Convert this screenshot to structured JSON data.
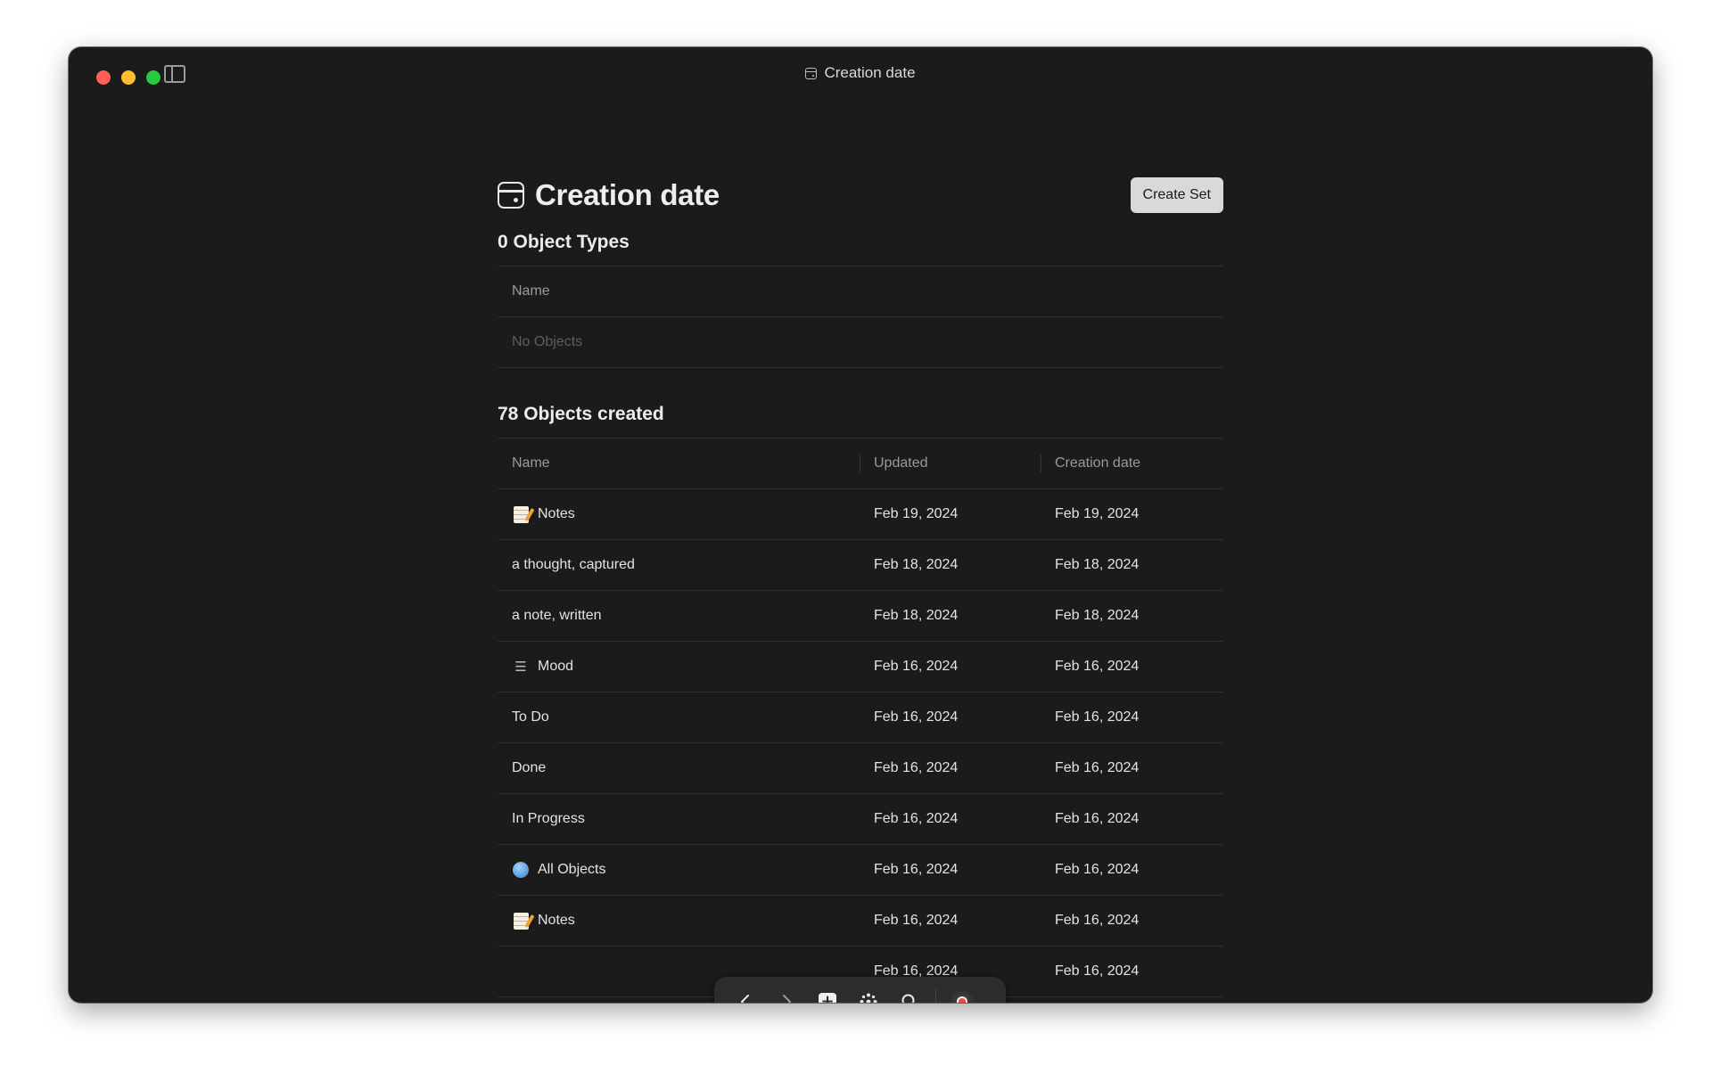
{
  "titlebar": {
    "title": "Creation date"
  },
  "header": {
    "title": "Creation date",
    "create_set_label": "Create Set"
  },
  "object_types": {
    "title": "0 Object Types",
    "column_name": "Name",
    "empty_text": "No Objects"
  },
  "objects": {
    "title": "78 Objects created",
    "columns": {
      "name": "Name",
      "updated": "Updated",
      "created": "Creation date"
    },
    "rows": [
      {
        "name": "Notes",
        "icon": "note-emoji",
        "updated": "Feb 19, 2024",
        "created": "Feb 19, 2024"
      },
      {
        "name": "a thought, captured",
        "icon": "",
        "updated": "Feb 18, 2024",
        "created": "Feb 18, 2024"
      },
      {
        "name": "a note, written",
        "icon": "",
        "updated": "Feb 18, 2024",
        "created": "Feb 18, 2024"
      },
      {
        "name": "Mood",
        "icon": "list-icon",
        "updated": "Feb 16, 2024",
        "created": "Feb 16, 2024"
      },
      {
        "name": "To Do",
        "icon": "",
        "updated": "Feb 16, 2024",
        "created": "Feb 16, 2024"
      },
      {
        "name": "Done",
        "icon": "",
        "updated": "Feb 16, 2024",
        "created": "Feb 16, 2024"
      },
      {
        "name": "In Progress",
        "icon": "",
        "updated": "Feb 16, 2024",
        "created": "Feb 16, 2024"
      },
      {
        "name": "All Objects",
        "icon": "globe-icon",
        "updated": "Feb 16, 2024",
        "created": "Feb 16, 2024"
      },
      {
        "name": "Notes",
        "icon": "note-emoji",
        "updated": "Feb 16, 2024",
        "created": "Feb 16, 2024"
      },
      {
        "name": "",
        "icon": "",
        "updated": "Feb 16, 2024",
        "created": "Feb 16, 2024"
      }
    ]
  },
  "dock": {
    "items": [
      "back-arrow-icon",
      "forward-arrow-icon",
      "plus-square-icon",
      "graph-icon",
      "search-icon",
      "avatar"
    ]
  },
  "help": {
    "label": "?"
  },
  "colors": {
    "background": "#1b1b1b",
    "accent_dot": "#f5a623",
    "button_bg": "#d9d9d9"
  }
}
